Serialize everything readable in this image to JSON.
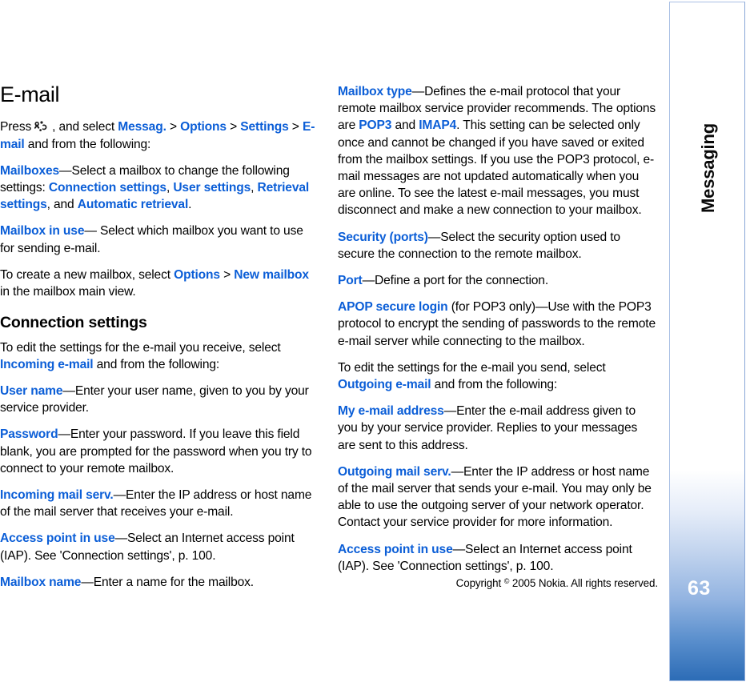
{
  "page": {
    "title": "E-mail",
    "chapter": "Messaging",
    "number": "63",
    "copyright_prefix": "Copyright ",
    "copyright_symbol": "©",
    "copyright_suffix": " 2005 Nokia. All rights reserved.",
    "accent_color": "#0b5ed7",
    "sidebar_border_color": "#a9c0e4",
    "sidebar_gradient_end": "#2c6cb6"
  },
  "icons": {
    "menu_key": "menu-key-icon"
  },
  "left_column": {
    "heading": "E-mail",
    "intro": {
      "press": "Press",
      "and_select": ", and select ",
      "menu_messag": "Messag.",
      "sep1": " > ",
      "menu_options": "Options",
      "sep2": " > ",
      "menu_settings": "Settings",
      "sep3": " > ",
      "menu_email": "E-mail",
      "tail": " and from the following:"
    },
    "mailboxes": {
      "term": "Mailboxes",
      "text1": "—Select a mailbox to change the following settings: ",
      "opt1": "Connection settings",
      "comma1": ", ",
      "opt2": "User settings",
      "comma2": ", ",
      "opt3": "Retrieval settings",
      "comma3": ", and ",
      "opt4": "Automatic retrieval",
      "period": "."
    },
    "mailbox_in_use": {
      "term": "Mailbox in use",
      "text": "— Select which mailbox you want to use for sending e-mail."
    },
    "new_mailbox": {
      "pre": "To create a new mailbox, select ",
      "opt1": "Options",
      "sep": " > ",
      "opt2": "New mailbox",
      "post": " in the mailbox main view."
    },
    "connection_settings_heading": "Connection settings",
    "incoming_intro": {
      "pre": "To edit the settings for the e-mail you receive, select ",
      "term": "Incoming e-mail",
      "post": " and from the following:"
    },
    "user_name": {
      "term": "User name",
      "text": "—Enter your user name, given to you by your service provider."
    },
    "password": {
      "term": "Password",
      "text": "—Enter your password. If you leave this field blank, you are prompted for the password when you try to connect to your remote mailbox."
    },
    "incoming_mail_serv": {
      "term": "Incoming mail serv.",
      "text": "—Enter the IP address or host name of the mail server that receives your e-mail."
    },
    "access_point_in_use": {
      "term": "Access point in use",
      "text": "—Select an Internet access point (IAP). See 'Connection settings', p. 100."
    },
    "mailbox_name": {
      "term": "Mailbox name",
      "text": "—Enter a name for the mailbox."
    }
  },
  "right_column": {
    "mailbox_type": {
      "term": "Mailbox type",
      "text1": "—Defines the e-mail protocol that your remote mailbox service provider recommends. The options are ",
      "opt1": "POP3",
      "and": " and ",
      "opt2": "IMAP4",
      "text2": ". This setting can be selected only once and cannot be changed if you have saved or exited from the mailbox settings. If you use the POP3 protocol, e-mail messages are not updated automatically when you are online. To see the latest e-mail messages, you must disconnect and make a new connection to your mailbox."
    },
    "security_ports": {
      "term": "Security (ports)",
      "text": "—Select the security option used to secure the connection to the remote mailbox."
    },
    "port": {
      "term": "Port",
      "text": "—Define a port for the connection."
    },
    "apop": {
      "term": "APOP secure login",
      "text": " (for POP3 only)—Use with the POP3 protocol to encrypt the sending of passwords to the remote e-mail server while connecting to the mailbox."
    },
    "outgoing_intro": {
      "pre": "To edit the settings for the e-mail you send, select ",
      "term": "Outgoing e-mail",
      "post": " and from the following:"
    },
    "my_email_address": {
      "term": "My e-mail address",
      "text": "—Enter the e-mail address given to you by your service provider. Replies to your messages are sent to this address."
    },
    "outgoing_mail_serv": {
      "term": "Outgoing mail serv.",
      "text": "—Enter the IP address or host name of the mail server that sends your e-mail. You may only be able to use the outgoing server of your network operator. Contact your service provider for more information."
    },
    "access_point_in_use": {
      "term": "Access point in use",
      "text": "—Select an Internet access point (IAP). See 'Connection settings', p. 100."
    }
  }
}
